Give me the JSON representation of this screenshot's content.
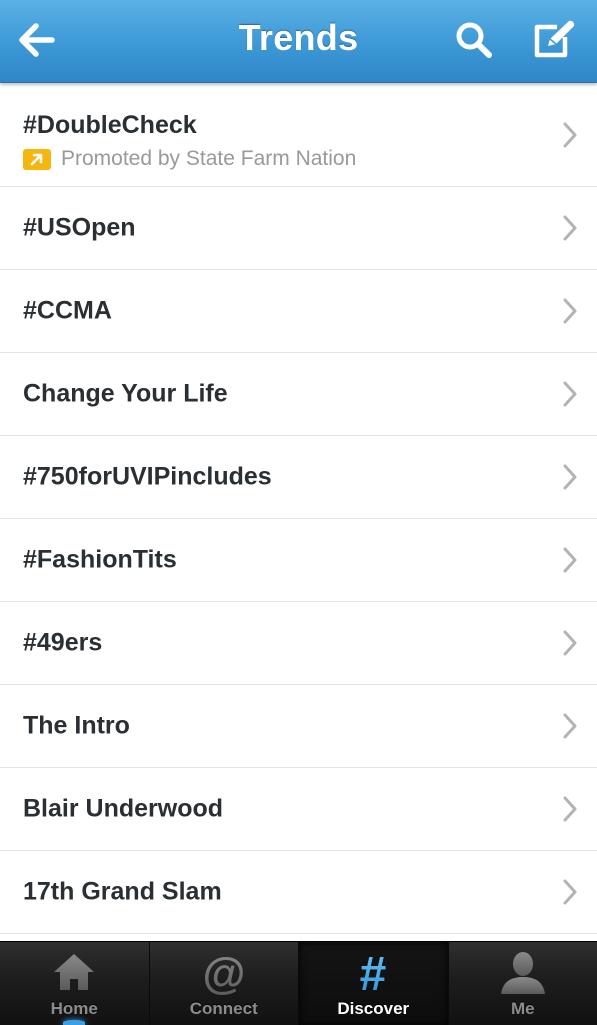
{
  "header": {
    "title": "Trends",
    "back_icon": "back-arrow-icon",
    "search_icon": "search-icon",
    "compose_icon": "compose-icon",
    "background_color": "#3d98d6"
  },
  "trends": [
    {
      "name": "#DoubleCheck",
      "promoted": "Promoted by State Farm Nation"
    },
    {
      "name": "#USOpen"
    },
    {
      "name": "#CCMA"
    },
    {
      "name": "Change Your Life"
    },
    {
      "name": "#750forUVIPincludes"
    },
    {
      "name": "#FashionTits"
    },
    {
      "name": "#49ers"
    },
    {
      "name": "The Intro"
    },
    {
      "name": "Blair Underwood"
    },
    {
      "name": "17th Grand Slam"
    }
  ],
  "promoted_badge_color": "#f5b70f",
  "tabbar": {
    "tabs": [
      {
        "label": "Home",
        "icon": "home-icon"
      },
      {
        "label": "Connect",
        "icon": "at-sign-icon"
      },
      {
        "label": "Discover",
        "icon": "hashtag-icon",
        "active": true
      },
      {
        "label": "Me",
        "icon": "person-icon"
      }
    ],
    "active_color": "#3aa0e6"
  }
}
